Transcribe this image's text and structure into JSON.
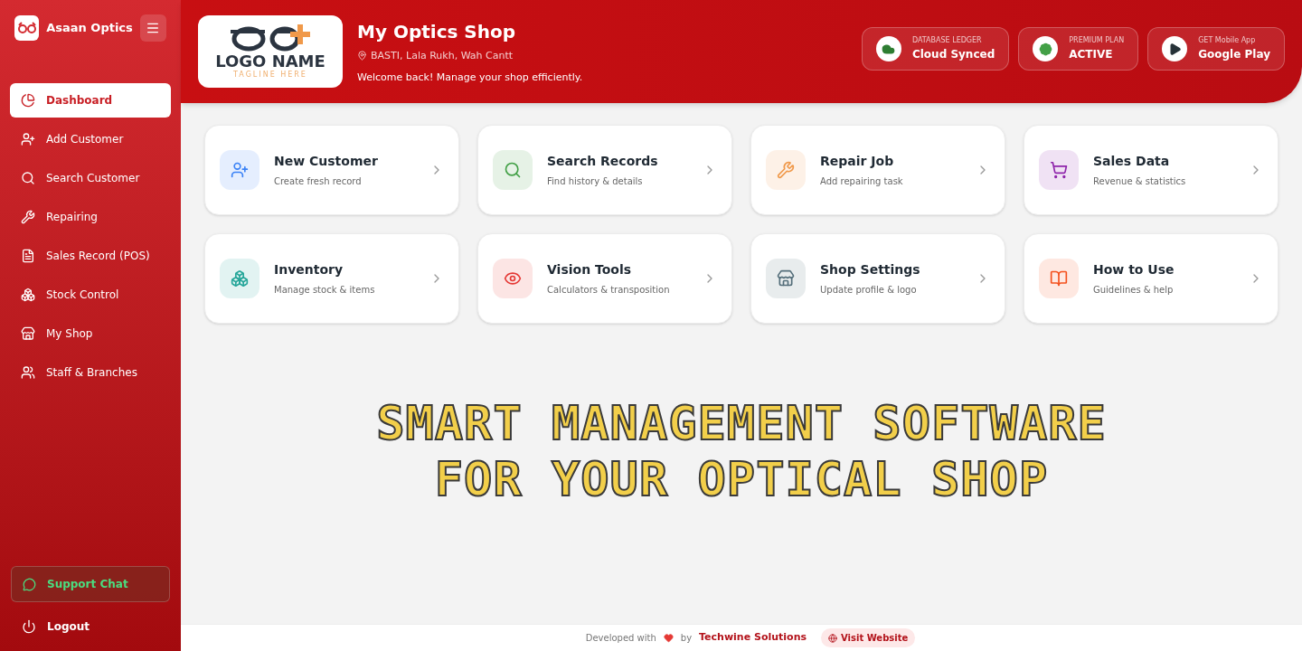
{
  "sidebar": {
    "brand": "Asaan Optics",
    "items": [
      {
        "label": "Dashboard",
        "selected": true
      },
      {
        "label": "Add Customer",
        "selected": false
      },
      {
        "label": "Search Customer",
        "selected": false
      },
      {
        "label": "Repairing",
        "selected": false
      },
      {
        "label": "Sales Record (POS)",
        "selected": false
      },
      {
        "label": "Stock Control",
        "selected": false
      },
      {
        "label": "My Shop",
        "selected": false
      },
      {
        "label": "Staff & Branches",
        "selected": false
      }
    ],
    "support": "Support Chat",
    "logout": "Logout"
  },
  "header": {
    "logo": {
      "name": "LOGO NAME",
      "tagline": "TAGLINE HERE"
    },
    "title": "My Optics Shop",
    "location": "BASTI, Lala Rukh, Wah Cantt",
    "welcome": "Welcome back! Manage your shop efficiently.",
    "badges": [
      {
        "label": "DATABASE LEDGER",
        "value": "Cloud Synced"
      },
      {
        "label": "PREMIUM PLAN",
        "value": "ACTIVE"
      },
      {
        "label": "GET Mobile App",
        "value": "Google Play"
      }
    ]
  },
  "cards": [
    {
      "title": "New Customer",
      "subtitle": "Create fresh record",
      "color": "#3b82f6"
    },
    {
      "title": "Search Records",
      "subtitle": "Find history & details",
      "color": "#43a047"
    },
    {
      "title": "Repair Job",
      "subtitle": "Add repairing task",
      "color": "#f0994a"
    },
    {
      "title": "Sales Data",
      "subtitle": "Revenue & statistics",
      "color": "#8e24aa"
    },
    {
      "title": "Inventory",
      "subtitle": "Manage stock & items",
      "color": "#26a69a"
    },
    {
      "title": "Vision Tools",
      "subtitle": "Calculators & transposition",
      "color": "#e53935"
    },
    {
      "title": "Shop Settings",
      "subtitle": "Update profile & logo",
      "color": "#546e7a"
    },
    {
      "title": "How to Use",
      "subtitle": "Guidelines & help",
      "color": "#f4511e"
    }
  ],
  "headline": [
    "SMART MANAGEMENT SOFTWARE",
    "FOR YOUR OPTICAL SHOP"
  ],
  "footer": {
    "developed": "Developed with",
    "by": "by",
    "company": "Techwine Solutions",
    "link": "Visit Website"
  }
}
